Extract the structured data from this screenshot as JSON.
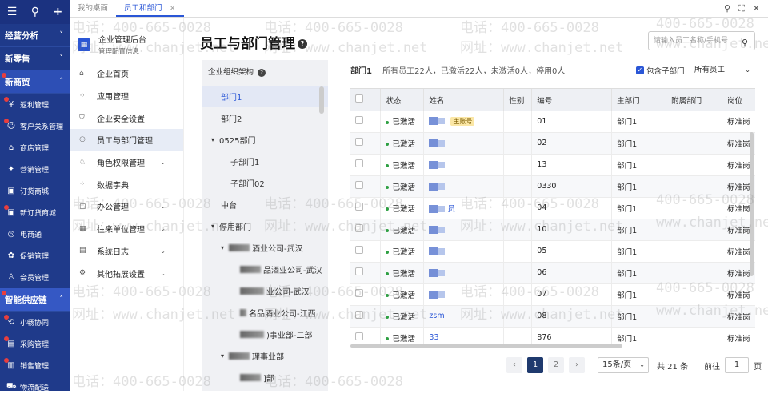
{
  "nav": {
    "sections_top": [
      {
        "label": "经营分析",
        "active": false
      },
      {
        "label": "新零售",
        "active": false
      },
      {
        "label": "新商贸",
        "active": true
      }
    ],
    "items_a": [
      {
        "label": "返利管理",
        "icon": "rebate-icon",
        "dot": true
      },
      {
        "label": "客户关系管理",
        "icon": "crm-icon",
        "dot": true
      },
      {
        "label": "商店管理",
        "icon": "store-icon",
        "dot": false
      },
      {
        "label": "营销管理",
        "icon": "marketing-icon",
        "dot": false
      },
      {
        "label": "订货商城",
        "icon": "order-mall-icon",
        "dot": false
      },
      {
        "label": "新订货商城",
        "icon": "new-order-mall-icon",
        "dot": true
      },
      {
        "label": "电商通",
        "icon": "ecommerce-icon",
        "dot": false
      },
      {
        "label": "促销管理",
        "icon": "promo-icon",
        "dot": false
      },
      {
        "label": "会员管理",
        "icon": "member-icon",
        "dot": false
      }
    ],
    "section_supply": "智能供应链",
    "items_b": [
      {
        "label": "小畅协同",
        "icon": "collab-icon",
        "dot": true
      },
      {
        "label": "采购管理",
        "icon": "purchase-icon",
        "dot": true
      },
      {
        "label": "销售管理",
        "icon": "sales-icon",
        "dot": true
      },
      {
        "label": "物流配送",
        "icon": "logistics-icon",
        "dot": false
      }
    ]
  },
  "tabs": [
    {
      "label": "我的桌面",
      "active": false
    },
    {
      "label": "员工和部门",
      "active": true,
      "close": "×"
    }
  ],
  "submenu": {
    "title": "企业管理后台",
    "subtitle": "管理配置信息",
    "items": [
      {
        "label": "企业首页",
        "icon": "home-icon",
        "chev": false,
        "active": false
      },
      {
        "label": "应用管理",
        "icon": "apps-icon",
        "chev": false,
        "active": false
      },
      {
        "label": "企业安全设置",
        "icon": "shield-icon",
        "chev": false,
        "active": false
      },
      {
        "label": "员工与部门管理",
        "icon": "users-icon",
        "chev": false,
        "active": true
      },
      {
        "label": "角色权限管理",
        "icon": "role-icon",
        "chev": true,
        "active": false
      },
      {
        "label": "数据字典",
        "icon": "dict-icon",
        "chev": false,
        "active": false
      },
      {
        "label": "办公管理",
        "icon": "office-icon",
        "chev": true,
        "active": false
      },
      {
        "label": "往来单位管理",
        "icon": "partner-icon",
        "chev": true,
        "active": false
      },
      {
        "label": "系统日志",
        "icon": "log-icon",
        "chev": true,
        "active": false
      },
      {
        "label": "其他拓展设置",
        "icon": "settings-icon",
        "chev": true,
        "active": false
      }
    ]
  },
  "page": {
    "title": "员工与部门管理",
    "search_placeholder": "请输入员工名称/手机号"
  },
  "tree": {
    "header": "企业组织架构",
    "nodes": [
      {
        "label": "部门1",
        "indent": 0,
        "arrow": "",
        "sel": true
      },
      {
        "label": "部门2",
        "indent": 0,
        "arrow": "",
        "sel": false
      },
      {
        "label": "0525部门",
        "indent": 0,
        "arrow": "▾",
        "sel": false
      },
      {
        "label": "子部门1",
        "indent": 1,
        "arrow": "",
        "sel": false
      },
      {
        "label": "子部门02",
        "indent": 1,
        "arrow": "",
        "sel": false
      },
      {
        "label": "中台",
        "indent": 0,
        "arrow": "",
        "sel": false
      },
      {
        "label": "停用部门",
        "indent": 0,
        "arrow": "▾",
        "sel": false
      },
      {
        "label": "酒业公司-武汉",
        "indent": 1,
        "arrow": "▾",
        "sel": false,
        "blur": 26
      },
      {
        "label": "品酒业公司-武汉",
        "indent": 2,
        "arrow": "",
        "sel": false,
        "blur": 26
      },
      {
        "label": "业公司-武汉",
        "indent": 2,
        "arrow": "",
        "sel": false,
        "blur": 30
      },
      {
        "label": "名品酒业公司-江西",
        "indent": 2,
        "arrow": "",
        "sel": false,
        "blur": 8
      },
      {
        "label": ")事业部-二部",
        "indent": 2,
        "arrow": "",
        "sel": false,
        "blur": 30
      },
      {
        "label": "理事业部",
        "indent": 1,
        "arrow": "▾",
        "sel": false,
        "blur": 26
      },
      {
        "label": "]部",
        "indent": 2,
        "arrow": "",
        "sel": false,
        "blur": 26
      }
    ]
  },
  "dept_summary": {
    "name": "部门1",
    "text": "所有员工22人，已激活22人，未激活0人，停用0人"
  },
  "include_sub": "包含子部门",
  "employee_filter": "所有员工",
  "table": {
    "headers": [
      "状态",
      "姓名",
      "性别",
      "编号",
      "主部门",
      "附属部门",
      "岗位"
    ],
    "rows": [
      {
        "status": "已激活",
        "name": "",
        "badge": "主账号",
        "gender": "",
        "code": "01",
        "dept": "部门1",
        "sub": "",
        "post": "标准岗"
      },
      {
        "status": "已激活",
        "name": "",
        "badge": "",
        "gender": "",
        "code": "02",
        "dept": "部门1",
        "sub": "",
        "post": "标准岗"
      },
      {
        "status": "已激活",
        "name": "",
        "badge": "",
        "gender": "",
        "code": "13",
        "dept": "部门1",
        "sub": "",
        "post": "标准岗"
      },
      {
        "status": "已激活",
        "name": "",
        "badge": "",
        "gender": "",
        "code": "0330",
        "dept": "部门1",
        "sub": "",
        "post": "标准岗"
      },
      {
        "status": "已激活",
        "name": "员",
        "badge": "",
        "gender": "",
        "code": "04",
        "dept": "部门1",
        "sub": "",
        "post": "标准岗"
      },
      {
        "status": "已激活",
        "name": "",
        "badge": "",
        "gender": "",
        "code": "10",
        "dept": "部门1",
        "sub": "",
        "post": "标准岗"
      },
      {
        "status": "已激活",
        "name": "",
        "badge": "",
        "gender": "",
        "code": "05",
        "dept": "部门1",
        "sub": "",
        "post": "标准岗"
      },
      {
        "status": "已激活",
        "name": "",
        "badge": "",
        "gender": "",
        "code": "06",
        "dept": "部门1",
        "sub": "",
        "post": "标准岗"
      },
      {
        "status": "已激活",
        "name": "",
        "badge": "",
        "gender": "",
        "code": "07",
        "dept": "部门1",
        "sub": "",
        "post": "标准岗"
      },
      {
        "status": "已激活",
        "name": "zsm",
        "badge": "",
        "gender": "",
        "code": "08",
        "dept": "部门1",
        "sub": "",
        "post": "标准岗"
      },
      {
        "status": "已激活",
        "name": "33",
        "badge": "",
        "gender": "",
        "code": "876",
        "dept": "部门1",
        "sub": "",
        "post": "标准岗"
      }
    ]
  },
  "pagination": {
    "pages": [
      "1",
      "2"
    ],
    "current": "1",
    "page_size": "15条/页",
    "total": "共 21 条",
    "goto_label": "前往",
    "goto_value": "1",
    "page_suffix": "页"
  },
  "watermark": {
    "phone": "电话：400-665-0028",
    "site": "网址：www.chanjet.net",
    "phone_short": "400-665-0028",
    "site_short": "www.chanjet.net"
  },
  "colors": {
    "nav_bg": "#1f3a8a",
    "accent": "#2a56d6",
    "active_status": "#2ea043"
  }
}
